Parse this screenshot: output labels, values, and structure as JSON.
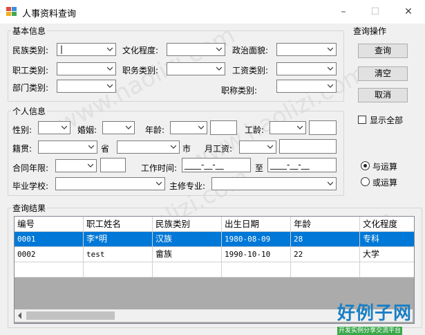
{
  "window": {
    "title": "人事资料查询",
    "min": "–",
    "max": "☐",
    "close": "✕"
  },
  "basic": {
    "legend": "基本信息",
    "ethnic_label": "民族类别:",
    "edu_label": "文化程度:",
    "political_label": "政治面貌:",
    "staff_type_label": "职工类别:",
    "duty_type_label": "职务类别:",
    "salary_type_label": "工资类别:",
    "dept_type_label": "部门类别:",
    "title_type_label": "职称类别:"
  },
  "personal": {
    "legend": "个人信息",
    "gender_label": "性别:",
    "marital_label": "婚姻:",
    "age_label": "年龄:",
    "seniority_label": "工龄:",
    "native_label": "籍贯:",
    "province_suffix": "省",
    "city_suffix": "市",
    "monthly_salary_label": "月工资:",
    "contract_label": "合同年限:",
    "work_time_label": "工作时间:",
    "to_label": "至",
    "date_placeholder": "____-__-__",
    "school_label": "毕业学校:",
    "major_label": "主修专业:"
  },
  "ops": {
    "legend": "查询操作",
    "query": "查询",
    "clear": "清空",
    "cancel": "取消",
    "show_all": "显示全部",
    "and_op": "与运算",
    "or_op": "或运算"
  },
  "results": {
    "legend": "查询结果",
    "columns": [
      "编号",
      "职工姓名",
      "民族类别",
      "出生日期",
      "年龄",
      "文化程度"
    ],
    "rows": [
      [
        "0001",
        "李*明",
        "汉族",
        "1980-08-09",
        "28",
        "专科"
      ],
      [
        "0002",
        "test",
        "畲族",
        "1990-10-10",
        "22",
        "大学"
      ]
    ]
  },
  "watermark": "www.haolizi.com",
  "brand": {
    "name": "好例子网",
    "tagline": "开发实例分享交流平台"
  },
  "colors": {
    "selection": "#0078d7",
    "brand_blue": "#1a7fc4",
    "brand_green": "#3aa84a"
  }
}
